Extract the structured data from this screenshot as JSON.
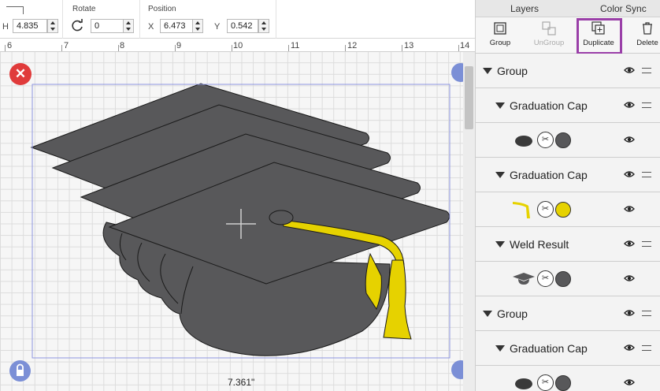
{
  "toolbar": {
    "h_label": "H",
    "h_value": "4.835",
    "rotate_label": "Rotate",
    "rotate_value": "0",
    "position_label": "Position",
    "x_label": "X",
    "x_value": "6.473",
    "y_label": "Y",
    "y_value": "0.542"
  },
  "ruler": {
    "marks": [
      "6",
      "7",
      "8",
      "9",
      "10",
      "11",
      "12",
      "13",
      "14"
    ]
  },
  "canvas": {
    "width_readout": "7.361\""
  },
  "panel": {
    "tabs": [
      "Layers",
      "Color Sync"
    ],
    "tools": {
      "group": "Group",
      "ungroup": "UnGroup",
      "duplicate": "Duplicate",
      "delete": "Delete"
    },
    "layers": [
      {
        "label": "Group"
      },
      {
        "label": "Graduation Cap"
      },
      {
        "label": ""
      },
      {
        "label": "Graduation Cap"
      },
      {
        "label": ""
      },
      {
        "label": "Weld Result"
      },
      {
        "label": ""
      },
      {
        "label": "Group"
      },
      {
        "label": "Graduation Cap"
      }
    ]
  },
  "colors": {
    "cap": "#58585a",
    "tassel": "#e6d200",
    "highlight": "#9a3fa8",
    "selection": "#8e96e0",
    "close_badge": "#e03b3b",
    "handle_badge": "#7b8fd6"
  }
}
